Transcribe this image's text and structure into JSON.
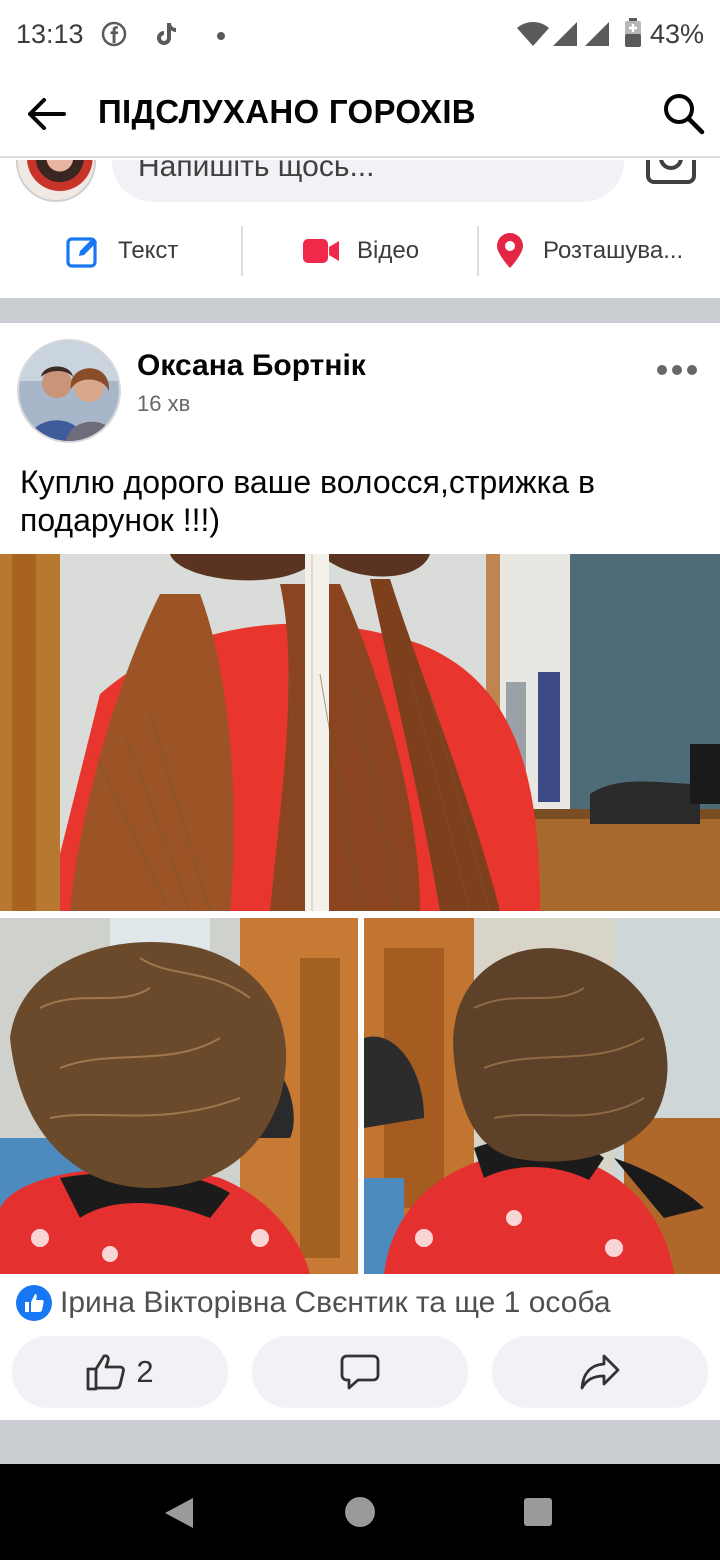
{
  "status_bar": {
    "time": "13:13",
    "battery_percent": "43%",
    "icons": [
      "facebook-icon",
      "tiktok-icon",
      "dot-icon",
      "wifi-icon",
      "signal-icon",
      "signal-icon",
      "battery-icon"
    ]
  },
  "app_bar": {
    "title": "ПІДСЛУХАНО ГОРОХІВ",
    "back_icon": "arrow-left-icon",
    "search_icon": "search-icon"
  },
  "composer": {
    "placeholder": "Напишіть щось...",
    "actions": [
      {
        "label": "Текст",
        "icon": "edit-icon",
        "color": "#1877f2"
      },
      {
        "label": "Відео",
        "icon": "video-camera-icon",
        "color": "#f02849"
      },
      {
        "label": "Розташува...",
        "icon": "location-pin-icon",
        "color": "#e42645"
      }
    ]
  },
  "post": {
    "author": "Оксана Бортнік",
    "time": "16 хв",
    "text": "Куплю дорого ваше волосся,стрижка в подарунок !!!)",
    "reactions_summary": "Ірина Вікторівна Свєнтик та ще 1 особа",
    "like_count": "2",
    "actions": [
      "like-button",
      "comment-button",
      "share-button"
    ]
  },
  "colors": {
    "facebook_blue": "#1877f2",
    "divider_grey": "#c9ccd1",
    "button_grey": "#f0f2f5"
  }
}
